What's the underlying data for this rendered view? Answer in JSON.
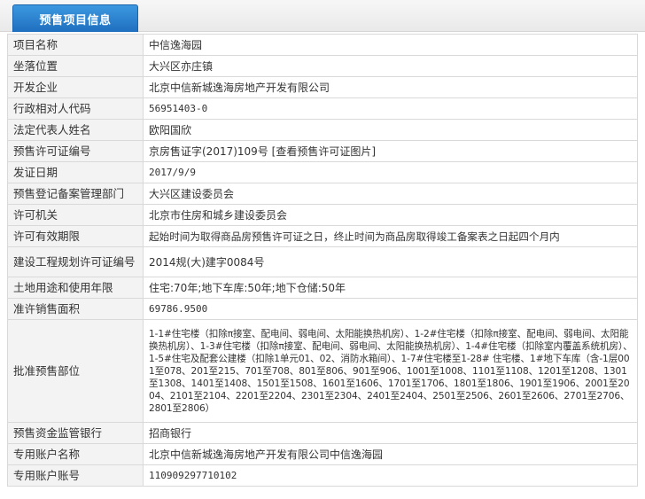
{
  "header": {
    "tab_label": "预售项目信息"
  },
  "rows": {
    "project_name": {
      "label": "项目名称",
      "value": "中信逸海园"
    },
    "location": {
      "label": "坐落位置",
      "value": "大兴区亦庄镇"
    },
    "developer": {
      "label": "开发企业",
      "value": "北京中信新城逸海房地产开发有限公司"
    },
    "admin_code": {
      "label": "行政相对人代码",
      "value": "56951403-0"
    },
    "legal_rep": {
      "label": "法定代表人姓名",
      "value": "欧阳国欣"
    },
    "permit_no": {
      "label": "预售许可证编号",
      "value": "京房售证字(2017)109号",
      "link": "[查看预售许可证图片]"
    },
    "issue_date": {
      "label": "发证日期",
      "value": "2017/9/9"
    },
    "registry_dept": {
      "label": "预售登记备案管理部门",
      "value": "大兴区建设委员会"
    },
    "permit_authority": {
      "label": "许可机关",
      "value": "北京市住房和城乡建设委员会"
    },
    "validity": {
      "label": "许可有效期限",
      "value": "起始时间为取得商品房预售许可证之日，终止时间为商品房取得竣工备案表之日起四个月内"
    },
    "planning_permit": {
      "label": "建设工程规划许可证编号",
      "value": "2014规(大)建字0084号"
    },
    "land_use": {
      "label": "土地用途和使用年限",
      "value": "住宅:70年;地下车库:50年;地下仓储:50年"
    },
    "sale_area": {
      "label": "准许销售面积",
      "value": "69786.9500"
    },
    "approved_parts": {
      "label": "批准预售部位",
      "value": "1-1#住宅楼（扣除π接室、配电间、弱电间、太阳能换热机房）、1-2#住宅楼（扣除π接室、配电间、弱电间、太阳能换热机房）、1-3#住宅楼（扣除π接室、配电间、弱电间、太阳能换热机房）、1-4#住宅楼（扣除室内覆盖系统机房）、1-5#住宅及配套公建楼（扣除1单元01、02、消防水箱间）、1-7#住宅楼至1-28# 住宅楼、1#地下车库（含-1层001至078、201至215、701至708、801至806、901至906、1001至1008、1101至1108、1201至1208、1301至1308、1401至1408、1501至1508、1601至1606、1701至1706、1801至1806、1901至1906、2001至2004、2101至2104、2201至2204、2301至2304、2401至2404、2501至2506、2601至2606、2701至2706、2801至2806）"
    },
    "supervising_bank": {
      "label": "预售资金监管银行",
      "value": "招商银行"
    },
    "account_name": {
      "label": "专用账户名称",
      "value": "北京中信新城逸海房地产开发有限公司中信逸海园"
    },
    "account_no": {
      "label": "专用账户账号",
      "value": "110909297710102"
    }
  }
}
